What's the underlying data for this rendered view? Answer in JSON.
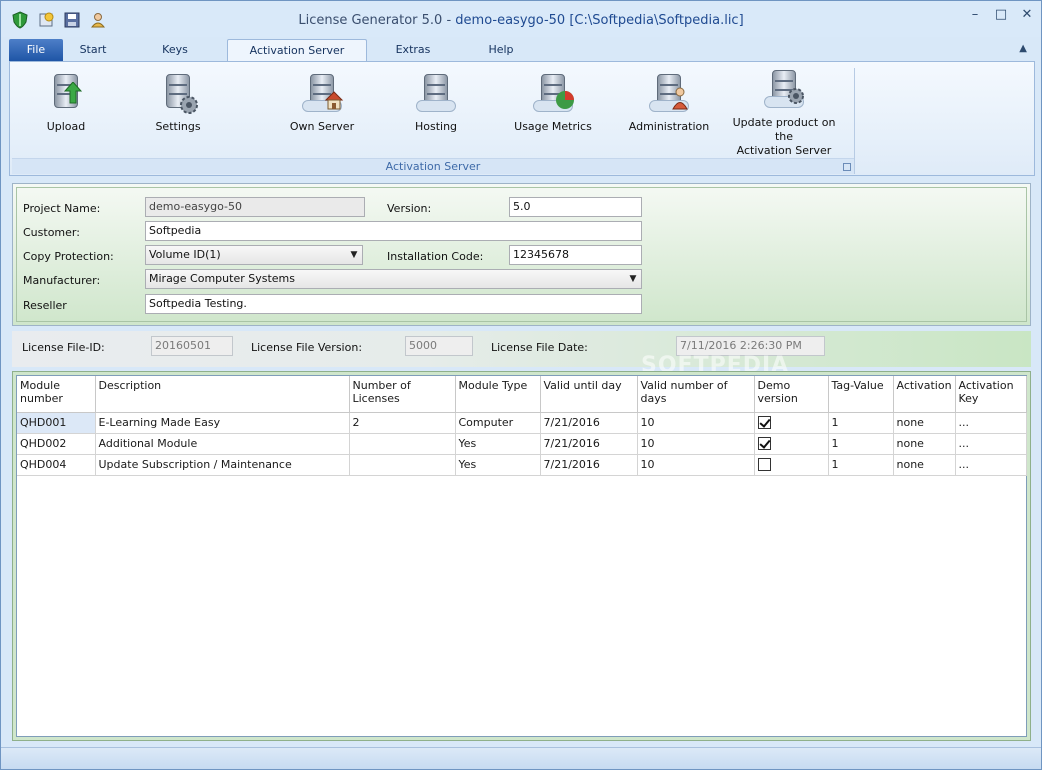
{
  "window": {
    "title_app": "License Generator 5.0",
    "title_sep": " - ",
    "title_doc": "demo-easygo-50 [C:\\Softpedia\\Softpedia.lic]"
  },
  "window_controls": {
    "minimize": "–",
    "maximize": "□",
    "close": "✕"
  },
  "tabs": [
    "File",
    "Start",
    "Keys",
    "Activation Server",
    "Extras",
    "Help"
  ],
  "ribbon": {
    "group_label": "Activation Server",
    "buttons": [
      {
        "label": "Upload",
        "icon": "upload-server-icon"
      },
      {
        "label": "Settings",
        "icon": "settings-server-icon"
      },
      {
        "label": "Own Server",
        "icon": "own-server-icon"
      },
      {
        "label": "Hosting",
        "icon": "hosting-server-icon"
      },
      {
        "label": "Usage Metrics",
        "icon": "usage-metrics-icon"
      },
      {
        "label": "Administration",
        "icon": "administration-icon"
      },
      {
        "label": "Update product on the",
        "label2": "Activation Server",
        "icon": "update-product-icon"
      }
    ]
  },
  "form": {
    "project_name_label": "Project Name:",
    "project_name": "demo-easygo-50",
    "version_label": "Version:",
    "version": "5.0",
    "customer_label": "Customer:",
    "customer": "Softpedia",
    "copy_protection_label": "Copy Protection:",
    "copy_protection": "Volume ID(1)",
    "installation_code_label": "Installation Code:",
    "installation_code": "12345678",
    "manufacturer_label": "Manufacturer:",
    "manufacturer": "Mirage Computer Systems",
    "reseller_label": "Reseller",
    "reseller": "Softpedia Testing."
  },
  "license_info": {
    "file_id_label": "License File-ID:",
    "file_id": "20160501",
    "file_version_label": "License File Version:",
    "file_version": "5000",
    "file_date_label": "License File Date:",
    "file_date": "7/11/2016 2:26:30 PM"
  },
  "watermark": "SOFTPEDIA",
  "grid": {
    "columns": [
      "Module number",
      "Description",
      "Number of Licenses",
      "Module Type",
      "Valid until day",
      "Valid number of days",
      "Demo version",
      "Tag-Value",
      "Activation",
      "Activation Key"
    ],
    "rows": [
      {
        "module": "QHD001",
        "desc": "E-Learning Made Easy",
        "licenses": "2",
        "type": "Computer",
        "until": "7/21/2016",
        "days": "10",
        "demo": true,
        "tag": "1",
        "activation": "none",
        "key": "..."
      },
      {
        "module": "QHD002",
        "desc": "Additional Module",
        "licenses": "",
        "type": "Yes",
        "until": "7/21/2016",
        "days": "10",
        "demo": true,
        "tag": "1",
        "activation": "none",
        "key": "..."
      },
      {
        "module": "QHD004",
        "desc": "Update Subscription / Maintenance",
        "licenses": "",
        "type": "Yes",
        "until": "7/21/2016",
        "days": "10",
        "demo": false,
        "tag": "1",
        "activation": "none",
        "key": "..."
      }
    ]
  }
}
